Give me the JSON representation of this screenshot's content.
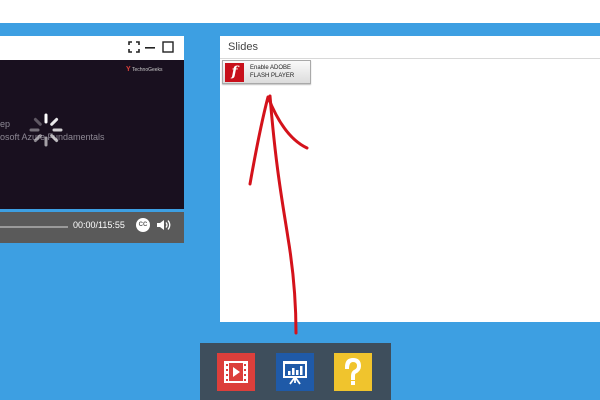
{
  "video_panel": {
    "logo_text": "TechnoGeeks",
    "title_line1": "ep",
    "title_line2": "osoft Azure Fundamentals",
    "time": "00:00/115:55",
    "cc_label": "CC"
  },
  "slides_panel": {
    "title": "Slides",
    "flash_button": {
      "line1": "Enable ADOBE",
      "line2": "FLASH PLAYER",
      "logo_glyph": "f"
    }
  },
  "dock": {
    "items": [
      {
        "name": "video",
        "icon": "film-play-icon",
        "color": "#dc3f3b"
      },
      {
        "name": "slides",
        "icon": "presentation-board-icon",
        "color": "#1f5aa8"
      },
      {
        "name": "help",
        "icon": "question-mark-icon",
        "color": "#f0c42d"
      }
    ]
  },
  "colors": {
    "background": "#3d9fe2",
    "annotation_arrow": "#d4121b",
    "dock": "#3e4e5c"
  }
}
